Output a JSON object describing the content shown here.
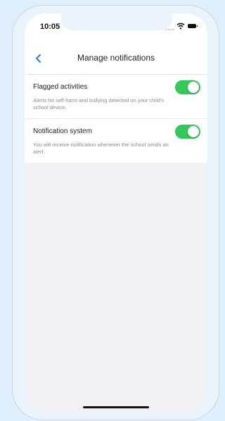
{
  "status_bar": {
    "time": "10:05"
  },
  "header": {
    "title": "Manage notifications",
    "back_icon": "chevron-left-icon"
  },
  "settings": [
    {
      "title": "Flagged activities",
      "description": "Alerts for self-harm and bullying detected on your child's school device.",
      "enabled": true
    },
    {
      "title": "Notification system",
      "description": "You will receive notification whenever the school sends an alert.",
      "enabled": true
    }
  ],
  "colors": {
    "accent": "#2f7be0",
    "toggle_on": "#34c759",
    "background": "#dfeefb"
  }
}
